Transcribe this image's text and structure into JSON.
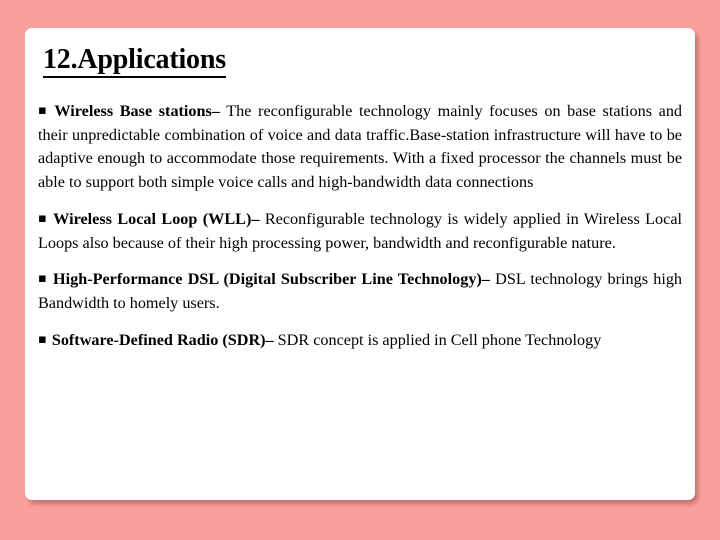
{
  "slide": {
    "background_color": "#faa09c",
    "card_color": "#ffffff",
    "title": "12.Applications"
  },
  "bullets": [
    {
      "marker": "square-bullet",
      "lead": "Wireless Base stations–",
      "rest": " The reconfigurable technology mainly focuses on base stations and their unpredictable combination of voice and data traffic.Base-station infrastructure will have to be adaptive enough to accommodate those requirements. With a fixed processor the channels must be able to support both simple voice calls and high-bandwidth data connections"
    },
    {
      "marker": "square-bullet",
      "lead": "Wireless Local Loop (WLL)–",
      "rest": " Reconfigurable technology is widely applied in Wireless Local Loops also because of their high processing power, bandwidth and reconfigurable nature."
    },
    {
      "marker": "square-bullet",
      "lead": "High-Performance DSL (Digital Subscriber Line Technology)–",
      "rest": " DSL technology brings high Bandwidth to homely users."
    },
    {
      "marker": "square-bullet",
      "lead": "Software-Defined Radio (SDR)–",
      "rest": " SDR concept is applied in Cell phone Technology"
    }
  ],
  "icons": {
    "square_bullet_glyph": "▪"
  }
}
